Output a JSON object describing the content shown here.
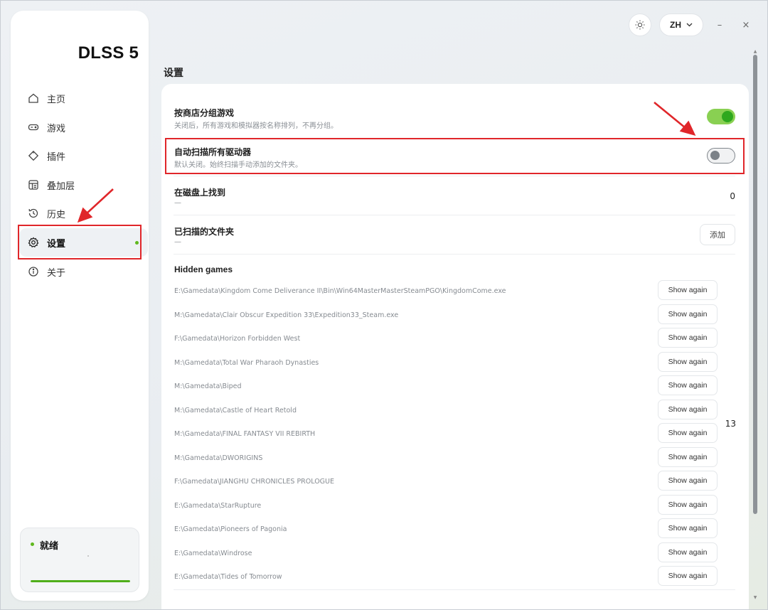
{
  "app": {
    "logo": "DLSS 5"
  },
  "topbar": {
    "theme_icon": "sun-icon",
    "language": "ZH",
    "minimize": "–",
    "close": "×"
  },
  "sidebar": {
    "items": [
      {
        "label": "主页",
        "icon": "home-icon"
      },
      {
        "label": "游戏",
        "icon": "gamepad-icon"
      },
      {
        "label": "插件",
        "icon": "puzzle-icon"
      },
      {
        "label": "叠加层",
        "icon": "overlay-icon"
      },
      {
        "label": "历史",
        "icon": "history-icon"
      },
      {
        "label": "设置",
        "icon": "gear-icon",
        "active": true
      },
      {
        "label": "关于",
        "icon": "info-icon"
      }
    ],
    "status": {
      "label": "就绪",
      "progress": 1.0,
      "color": "#4fae1a"
    }
  },
  "page": {
    "title": "设置"
  },
  "settings": {
    "group_by_store": {
      "title": "按商店分组游戏",
      "desc": "关闭后，所有游戏和模拟器按名称排列，不再分组。",
      "enabled": true
    },
    "auto_scan": {
      "title": "自动扫描所有驱动器",
      "desc": "默认关闭。始终扫描手动添加的文件夹。",
      "enabled": false
    },
    "found_on_disk": {
      "title": "在磁盘上找到",
      "desc": "—",
      "value": "0"
    },
    "scanned_folders": {
      "title": "已扫描的文件夹",
      "desc": "—",
      "add_label": "添加"
    },
    "hidden_games": {
      "title": "Hidden games",
      "count": "13",
      "button_label": "Show again",
      "items": [
        "E:\\Gamedata\\Kingdom Come Deliverance II\\Bin\\Win64MasterMasterSteamPGO\\KingdomCome.exe",
        "M:\\Gamedata\\Clair Obscur Expedition 33\\Expedition33_Steam.exe",
        "F:\\Gamedata\\Horizon Forbidden West",
        "M:\\Gamedata\\Total War Pharaoh Dynasties",
        "M:\\Gamedata\\Biped",
        "M:\\Gamedata\\Castle of Heart Retold",
        "M:\\Gamedata\\FINAL FANTASY VII REBIRTH",
        "M:\\Gamedata\\DWORIGINS",
        "F:\\Gamedata\\JIANGHU CHRONICLES PROLOGUE",
        "E:\\Gamedata\\StarRupture",
        "E:\\Gamedata\\Pioneers of Pagonia",
        "E:\\Gamedata\\Windrose",
        "E:\\Gamedata\\Tides of Tomorrow"
      ]
    }
  },
  "colors": {
    "accent": "#4fae1a",
    "toggle_on": "#89d052",
    "annotation": "#e0262a"
  }
}
